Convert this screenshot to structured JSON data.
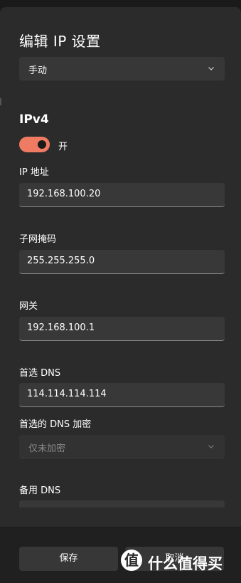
{
  "dialog": {
    "title": "编辑 IP 设置",
    "mode_select": {
      "value": "手动",
      "icon": "chevron-down-icon"
    },
    "ipv4": {
      "heading": "IPv4",
      "toggle": {
        "state": "on",
        "label": "开",
        "color": "#ef7b63"
      },
      "ip_address": {
        "label": "IP 地址",
        "value": "192.168.100.20"
      },
      "subnet_mask": {
        "label": "子网掩码",
        "value": "255.255.255.0"
      },
      "gateway": {
        "label": "网关",
        "value": "192.168.100.1"
      },
      "preferred_dns": {
        "label": "首选 DNS",
        "value": "114.114.114.114"
      },
      "preferred_dns_encryption": {
        "label": "首选的 DNS 加密",
        "value": "仅未加密",
        "icon": "chevron-down-icon"
      },
      "alternate_dns": {
        "label": "备用 DNS",
        "value": ""
      }
    }
  },
  "footer": {
    "save_label": "保存",
    "cancel_label": "取消"
  },
  "watermark": {
    "badge": "值",
    "text": "什么值得买"
  }
}
